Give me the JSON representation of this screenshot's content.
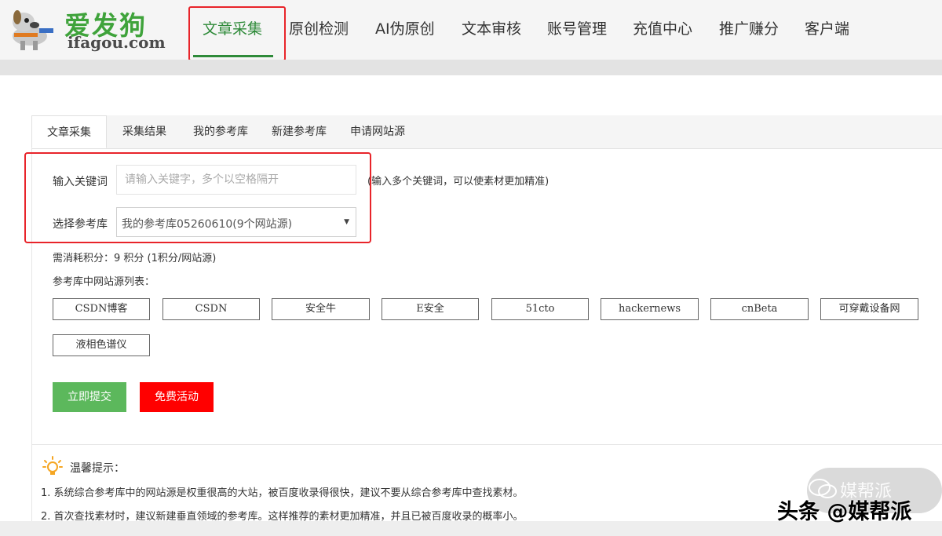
{
  "logo": {
    "brand": "爱发狗",
    "domain": "ifagou.com"
  },
  "nav": {
    "items": [
      "文章采集",
      "原创检测",
      "AI伪原创",
      "文本审核",
      "账号管理",
      "充值中心",
      "推广赚分",
      "客户端"
    ],
    "active_index": 0
  },
  "tabs": [
    "文章采集",
    "采集结果",
    "我的参考库",
    "新建参考库",
    "申请网站源"
  ],
  "form": {
    "keyword_label": "输入关键词",
    "keyword_placeholder": "请输入关键字，多个以空格隔开",
    "keyword_value": "",
    "keyword_hint": "(输入多个关键词，可以使素材更加精准)",
    "library_label": "选择参考库",
    "library_selected": "我的参考库05260610(9个网站源)"
  },
  "cost_text": "需消耗积分：9 积分 (1积分/网站源)",
  "sources_title": "参考库中网站源列表：",
  "sources": [
    "CSDN博客",
    "CSDN",
    "安全牛",
    "E安全",
    "51cto",
    "hackernews",
    "cnBeta",
    "可穿戴设备网",
    "液相色谱仪"
  ],
  "buttons": {
    "submit": "立即提交",
    "free": "免费活动"
  },
  "tips": {
    "title": "温馨提示：",
    "items": [
      "1.  系统综合参考库中的网站源是权重很高的大站，被百度收录得很快，建议不要从综合参考库中查找素材。",
      "2.  首次查找素材时，建议新建垂直领域的参考库。这样推荐的素材更加精准，并且已被百度收录的概率小。"
    ]
  },
  "watermark": {
    "small": "媒帮派",
    "main": "头条 @媒帮派"
  },
  "colors": {
    "brand_green": "#2e8a39",
    "submit_green": "#5cb85c",
    "free_red": "#ff0000",
    "highlight_red": "#e8242a"
  },
  "icons": {
    "tips": "lightbulb-icon",
    "dropdown": "chevron-down-icon"
  }
}
